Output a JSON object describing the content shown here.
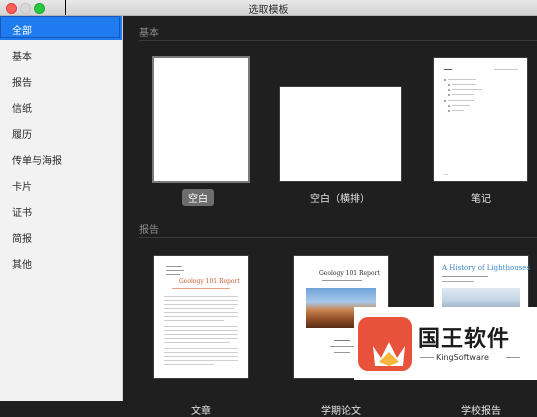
{
  "window": {
    "title": "选取模板"
  },
  "sidebar": {
    "items": [
      {
        "label": "全部",
        "active": true
      },
      {
        "label": "基本"
      },
      {
        "label": "报告"
      },
      {
        "label": "信纸"
      },
      {
        "label": "履历"
      },
      {
        "label": "传单与海报"
      },
      {
        "label": "卡片"
      },
      {
        "label": "证书"
      },
      {
        "label": "简报"
      },
      {
        "label": "其他"
      }
    ]
  },
  "sections": [
    {
      "label": "基本",
      "templates": [
        {
          "label": "空白",
          "selected": true
        },
        {
          "label": "空白（横排）"
        },
        {
          "label": "笔记"
        }
      ]
    },
    {
      "label": "报告",
      "templates": [
        {
          "label": "文章",
          "heading": "Geology 101 Report"
        },
        {
          "label": "学期论文",
          "heading": "Geology 101 Report"
        },
        {
          "label": "学校报告",
          "heading": "A History of Lighthouses"
        }
      ]
    }
  ],
  "watermark": {
    "name_cn": "国王软件",
    "name_en": "KingSoftware",
    "colors": {
      "logo_bg": "#e9523a",
      "crown": "#ffffff",
      "crown_accent": "#f6b53d"
    }
  }
}
